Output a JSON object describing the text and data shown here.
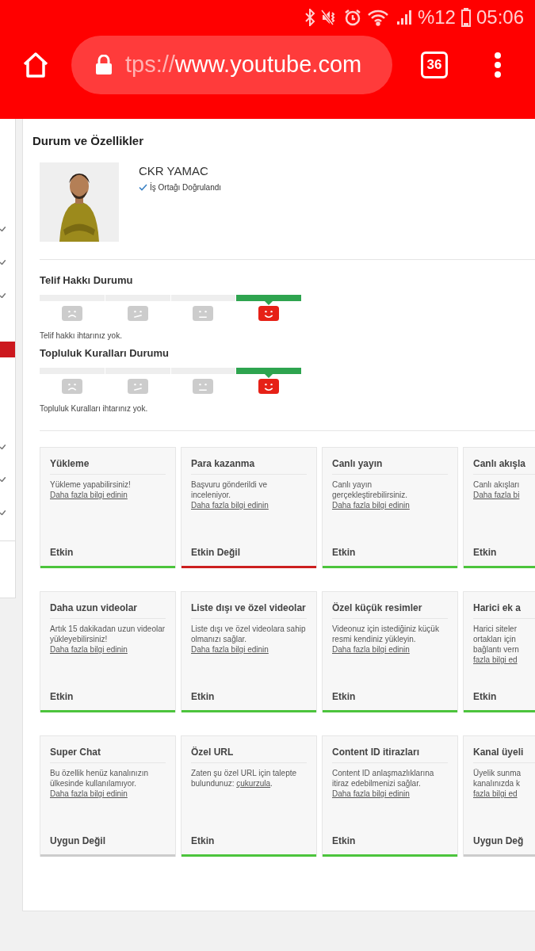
{
  "status_bar": {
    "battery_percent": "%12",
    "time": "05:06"
  },
  "browser": {
    "url_scheme": "tps://",
    "url_host": "www.youtube.com",
    "tab_count": "36"
  },
  "sidebar": {
    "items": [
      {
        "checked": true,
        "selected": false
      },
      {
        "checked": true,
        "selected": false
      },
      {
        "checked": true,
        "selected": false
      },
      {
        "checked": false,
        "selected": true
      },
      {
        "checked": true,
        "selected": false
      },
      {
        "checked": true,
        "selected": false
      },
      {
        "checked": true,
        "selected": false
      }
    ]
  },
  "page_title": "Durum ve Özellikler",
  "channel": {
    "name": "CKR YAMAC",
    "verified": "İş Ortağı Doğrulandı"
  },
  "strike_sections": [
    {
      "title": "Telif Hakkı Durumu",
      "segments": [
        {
          "selected": false
        },
        {
          "selected": false
        },
        {
          "selected": false
        },
        {
          "selected": true
        }
      ],
      "message": "Telif hakkı ihtarınız yok."
    },
    {
      "title": "Topluluk Kuralları Durumu",
      "segments": [
        {
          "selected": false
        },
        {
          "selected": false
        },
        {
          "selected": false
        },
        {
          "selected": true
        }
      ],
      "message": "Topluluk Kuralları ihtarınız yok."
    }
  ],
  "feature_rows": [
    [
      {
        "title": "Yükleme",
        "text": "Yükleme yapabilirsiniz! ",
        "link": "Daha fazla bilgi edinin",
        "status": "Etkin",
        "color": "#4cc43c"
      },
      {
        "title": "Para kazanma",
        "text": "Başvuru gönderildi ve inceleniyor. ",
        "link": "Daha fazla bilgi edinin",
        "status": "Etkin Değil",
        "color": "#cc1f1f"
      },
      {
        "title": "Canlı yayın",
        "text": "Canlı yayın gerçekleştirebilirsiniz. ",
        "link": "Daha fazla bilgi edinin",
        "status": "Etkin",
        "color": "#4cc43c"
      },
      {
        "title": "Canlı akışla",
        "lines": [
          {
            "text": "Canlı akışları",
            "link": false
          },
          {
            "text": "Daha fazla bi",
            "link": true
          }
        ],
        "status": "Etkin",
        "color": "#4cc43c"
      }
    ],
    [
      {
        "title": "Daha uzun videolar",
        "text": "Artık 15 dakikadan uzun videolar yükleyebilirsiniz! ",
        "link": "Daha fazla bilgi edinin",
        "status": "Etkin",
        "color": "#4cc43c"
      },
      {
        "title": "Liste dışı ve özel videolar",
        "text": "Liste dışı ve özel videolara sahip olmanızı sağlar. ",
        "link": "Daha fazla bilgi edinin",
        "status": "Etkin",
        "color": "#4cc43c"
      },
      {
        "title": "Özel küçük resimler",
        "text": "Videonuz için istediğiniz küçük resmi kendiniz yükleyin. ",
        "link": "Daha fazla bilgi edinin",
        "status": "Etkin",
        "color": "#4cc43c"
      },
      {
        "title": "Harici ek a",
        "lines": [
          {
            "text": "Harici siteler",
            "link": false
          },
          {
            "text": "ortakları için",
            "link": false
          },
          {
            "text": "bağlantı vern",
            "link": false
          },
          {
            "text": "fazla bilgi ed",
            "link": true
          }
        ],
        "status": "Etkin",
        "color": "#4cc43c"
      }
    ],
    [
      {
        "title": "Super Chat",
        "text": "Bu özellik henüz kanalınızın ülkesinde kullanılamıyor. ",
        "link": "Daha fazla bilgi edinin",
        "status": "Uygun Değil",
        "color": "#cccccc"
      },
      {
        "title": "Özel URL",
        "text": "Zaten şu özel URL için talepte bulundunuz: ",
        "link": "çukurzula",
        "after": ".",
        "status": "Etkin",
        "color": "#4cc43c"
      },
      {
        "title": "Content ID itirazları",
        "text": "Content ID anlaşmazlıklarına itiraz edebilmenizi sağlar. ",
        "link": "Daha fazla bilgi edinin",
        "status": "Etkin",
        "color": "#4cc43c"
      },
      {
        "title": "Kanal üyeli",
        "lines": [
          {
            "text": "Üyelik sunma",
            "link": false
          },
          {
            "text": "kanalınızda k",
            "link": false
          },
          {
            "text": "fazla bilgi ed",
            "link": true
          }
        ],
        "status": "Uygun Değ",
        "color": "#cccccc"
      }
    ]
  ]
}
